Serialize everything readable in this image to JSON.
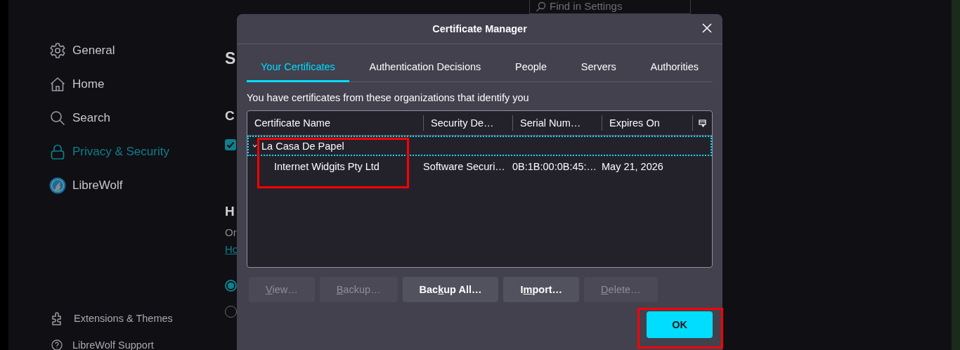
{
  "search": {
    "placeholder": "Find in Settings"
  },
  "sidebar": {
    "items": [
      {
        "label": "General",
        "selected": false
      },
      {
        "label": "Home",
        "selected": false
      },
      {
        "label": "Search",
        "selected": false
      },
      {
        "label": "Privacy & Security",
        "selected": true
      },
      {
        "label": "LibreWolf",
        "selected": false
      }
    ],
    "footer_items": [
      {
        "label": "Extensions & Themes"
      },
      {
        "label": "LibreWolf Support"
      }
    ]
  },
  "content": [
    {
      "kind": "heading",
      "text": "S"
    },
    {
      "kind": "subheading",
      "text": "C"
    },
    {
      "kind": "checkbox",
      "checked": true
    },
    {
      "kind": "subheading",
      "text": "H"
    },
    {
      "kind": "text",
      "text": "Or"
    },
    {
      "kind": "link",
      "text": "Ho"
    },
    {
      "kind": "radio",
      "selected": true
    },
    {
      "kind": "radio",
      "selected": false
    }
  ],
  "dialog": {
    "title": "Certificate Manager",
    "tabs": [
      {
        "label": "Your Certificates",
        "selected": true
      },
      {
        "label": "Authentication Decisions",
        "selected": false
      },
      {
        "label": "People",
        "selected": false
      },
      {
        "label": "Servers",
        "selected": false
      },
      {
        "label": "Authorities",
        "selected": false
      }
    ],
    "description": "You have certificates from these organizations that identify you",
    "tree": {
      "columns": [
        "Certificate Name",
        "Security De…",
        "Serial Num…",
        "Expires On"
      ],
      "rows": [
        {
          "label": "La Casa De Papel",
          "expanded": true,
          "selected": true,
          "highlighted": true,
          "children": [
            {
              "cells": [
                "Internet Widgits Pty Ltd",
                "Software Securi…",
                "0B:1B:00:0B:45:…",
                "May 21, 2026"
              ]
            }
          ]
        }
      ]
    },
    "buttons": [
      {
        "accesskey": "V",
        "label_end": "iew…",
        "disabled": true
      },
      {
        "accesskey": "B",
        "label_end": "ackup…",
        "disabled": true
      },
      {
        "label_start": "Bac",
        "accesskey": "k",
        "label_end": "up All…",
        "disabled": false
      },
      {
        "label_start": "I",
        "accesskey": "m",
        "label_end": "port…",
        "disabled": false
      },
      {
        "accesskey": "D",
        "label_end": "elete…",
        "disabled": true
      }
    ],
    "ok_button": {
      "label": "OK",
      "highlighted": true
    }
  }
}
